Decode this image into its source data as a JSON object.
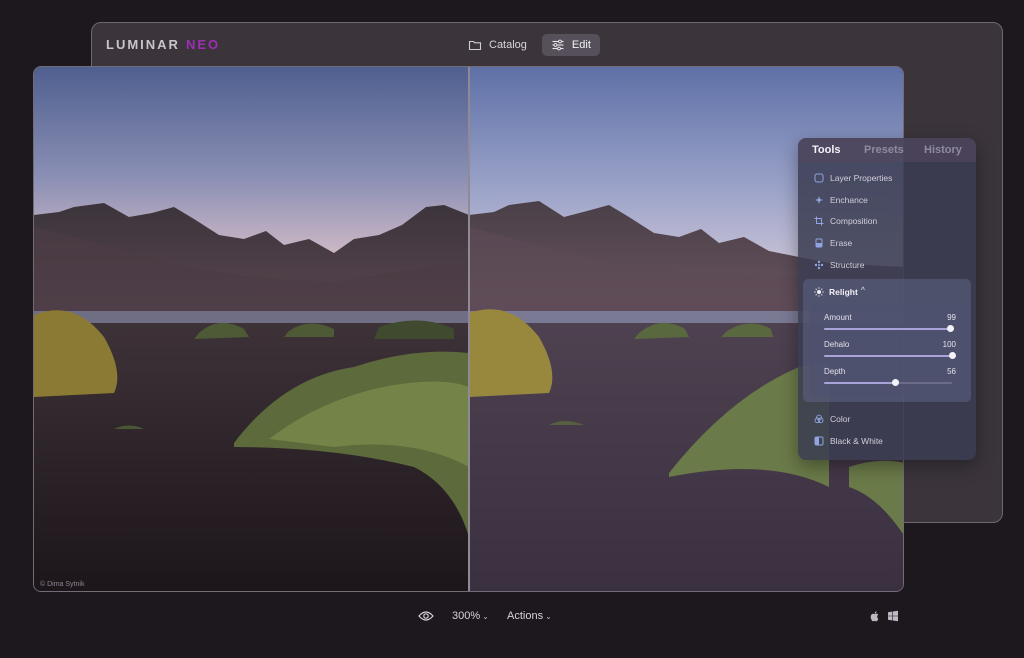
{
  "app": {
    "brand": "LUMINAR",
    "brand_suffix": "NEO"
  },
  "topnav": [
    {
      "label": "Catalog",
      "icon": "folder-icon",
      "active": false
    },
    {
      "label": "Edit",
      "icon": "sliders-icon",
      "active": true
    }
  ],
  "photo": {
    "credit": "© Dima Sytnik"
  },
  "panel": {
    "tabs": [
      {
        "label": "Tools",
        "active": true
      },
      {
        "label": "Presets",
        "active": false
      },
      {
        "label": "History",
        "active": false
      }
    ],
    "tools_top": [
      {
        "label": "Layer Properties",
        "icon": "layers-icon"
      },
      {
        "label": "Enchance",
        "icon": "enhance-icon"
      },
      {
        "label": "Composition",
        "icon": "crop-icon"
      },
      {
        "label": "Erase",
        "icon": "eraser-icon"
      },
      {
        "label": "Structure",
        "icon": "structure-icon"
      }
    ],
    "relight": {
      "label": "Relight",
      "caret": "^",
      "sliders": [
        {
          "label": "Amount",
          "value": "99",
          "level": 0.99
        },
        {
          "label": "Dehalo",
          "value": "100",
          "level": 1.0
        },
        {
          "label": "Depth",
          "value": "56",
          "level": 0.56
        }
      ]
    },
    "tools_bottom": [
      {
        "label": "Color",
        "icon": "color-icon"
      },
      {
        "label": "Black & White",
        "icon": "black-white-icon"
      }
    ]
  },
  "bottom": {
    "zoom": "300%",
    "actions": "Actions"
  },
  "colors": {
    "accent": "#9b2fb4",
    "slider_fill": "#a9a3d8"
  }
}
